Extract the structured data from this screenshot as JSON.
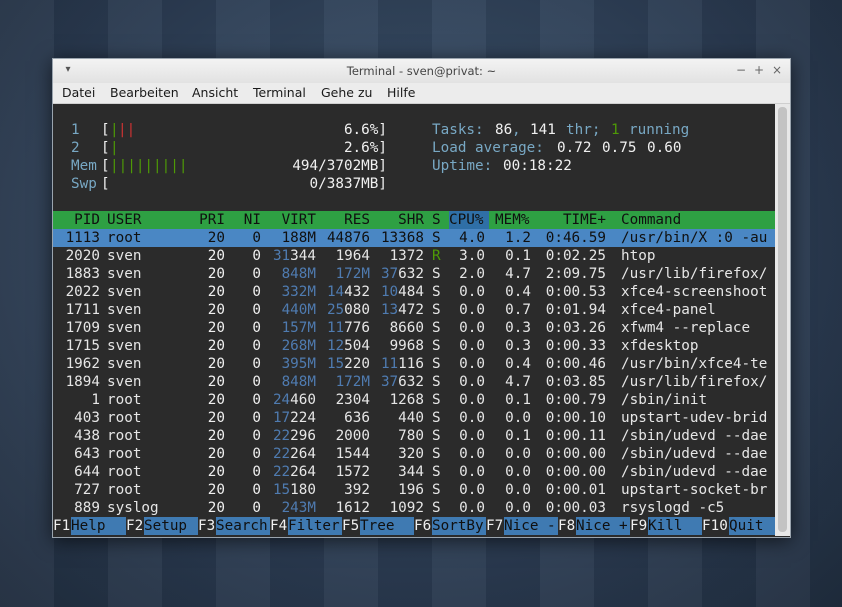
{
  "window": {
    "title": "Terminal - sven@privat: ~",
    "controls": {
      "menu": "▾",
      "minimize": "−",
      "maximize": "+",
      "close": "×"
    }
  },
  "menubar": [
    "Datei",
    "Bearbeiten",
    "Ansicht",
    "Terminal",
    "Gehe zu",
    "Hilfe"
  ],
  "meters": {
    "cpu1": {
      "label": "1",
      "open": "[",
      "bar_red": "||",
      "bar_green": "|",
      "value": "6.6%]"
    },
    "cpu2": {
      "label": "2",
      "open": "[",
      "bar_green": "|",
      "value": "2.6%]"
    },
    "mem": {
      "label": "Mem",
      "open": "[",
      "bar_green": "|||||||||",
      "value": "494/3702MB]"
    },
    "swp": {
      "label": "Swp",
      "open": "[",
      "value": "0/3837MB]"
    }
  },
  "stats": {
    "tasks_label": "Tasks:",
    "tasks": "86",
    "thr_count": "141",
    "thr_label": "thr;",
    "running_count": "1",
    "running_label": "running",
    "load_label": "Load average:",
    "load1": "0.72",
    "load5": "0.75",
    "load15": "0.60",
    "uptime_label": "Uptime:",
    "uptime": "00:18:22"
  },
  "table": {
    "headers": [
      "PID",
      "USER",
      "PRI",
      "NI",
      "VIRT",
      "RES",
      "SHR",
      "S",
      "CPU%",
      "MEM%",
      "TIME+",
      "Command"
    ],
    "sorted_column": "CPU%",
    "selected_row": 0,
    "rows": [
      {
        "pid": "1113",
        "user": "root",
        "pri": "20",
        "ni": "0",
        "virt": "188M",
        "res": "44876",
        "shr": "13368",
        "s": "S",
        "cpu": "4.0",
        "mem": "1.2",
        "time": "0:46.59",
        "cmd": "/usr/bin/X :0 -au"
      },
      {
        "pid": "2020",
        "user": "sven",
        "pri": "20",
        "ni": "0",
        "virt": "31344",
        "res": "1964",
        "shr": "1372",
        "s": "R",
        "cpu": "3.0",
        "mem": "0.1",
        "time": "0:02.25",
        "cmd": "htop"
      },
      {
        "pid": "1883",
        "user": "sven",
        "pri": "20",
        "ni": "0",
        "virt": "848M",
        "res": "172M",
        "shr": "37632",
        "s": "S",
        "cpu": "2.0",
        "mem": "4.7",
        "time": "2:09.75",
        "cmd": "/usr/lib/firefox/"
      },
      {
        "pid": "2022",
        "user": "sven",
        "pri": "20",
        "ni": "0",
        "virt": "332M",
        "res": "14432",
        "shr": "10484",
        "s": "S",
        "cpu": "0.0",
        "mem": "0.4",
        "time": "0:00.53",
        "cmd": "xfce4-screenshoot"
      },
      {
        "pid": "1711",
        "user": "sven",
        "pri": "20",
        "ni": "0",
        "virt": "440M",
        "res": "25080",
        "shr": "13472",
        "s": "S",
        "cpu": "0.0",
        "mem": "0.7",
        "time": "0:01.94",
        "cmd": "xfce4-panel"
      },
      {
        "pid": "1709",
        "user": "sven",
        "pri": "20",
        "ni": "0",
        "virt": "157M",
        "res": "11776",
        "shr": "8660",
        "s": "S",
        "cpu": "0.0",
        "mem": "0.3",
        "time": "0:03.26",
        "cmd": "xfwm4 --replace"
      },
      {
        "pid": "1715",
        "user": "sven",
        "pri": "20",
        "ni": "0",
        "virt": "268M",
        "res": "12504",
        "shr": "9968",
        "s": "S",
        "cpu": "0.0",
        "mem": "0.3",
        "time": "0:00.33",
        "cmd": "xfdesktop"
      },
      {
        "pid": "1962",
        "user": "sven",
        "pri": "20",
        "ni": "0",
        "virt": "395M",
        "res": "15220",
        "shr": "11116",
        "s": "S",
        "cpu": "0.0",
        "mem": "0.4",
        "time": "0:00.46",
        "cmd": "/usr/bin/xfce4-te"
      },
      {
        "pid": "1894",
        "user": "sven",
        "pri": "20",
        "ni": "0",
        "virt": "848M",
        "res": "172M",
        "shr": "37632",
        "s": "S",
        "cpu": "0.0",
        "mem": "4.7",
        "time": "0:03.85",
        "cmd": "/usr/lib/firefox/"
      },
      {
        "pid": "1",
        "user": "root",
        "pri": "20",
        "ni": "0",
        "virt": "24460",
        "res": "2304",
        "shr": "1268",
        "s": "S",
        "cpu": "0.0",
        "mem": "0.1",
        "time": "0:00.79",
        "cmd": "/sbin/init"
      },
      {
        "pid": "403",
        "user": "root",
        "pri": "20",
        "ni": "0",
        "virt": "17224",
        "res": "636",
        "shr": "440",
        "s": "S",
        "cpu": "0.0",
        "mem": "0.0",
        "time": "0:00.10",
        "cmd": "upstart-udev-brid"
      },
      {
        "pid": "438",
        "user": "root",
        "pri": "20",
        "ni": "0",
        "virt": "22296",
        "res": "2000",
        "shr": "780",
        "s": "S",
        "cpu": "0.0",
        "mem": "0.1",
        "time": "0:00.11",
        "cmd": "/sbin/udevd --dae"
      },
      {
        "pid": "643",
        "user": "root",
        "pri": "20",
        "ni": "0",
        "virt": "22264",
        "res": "1544",
        "shr": "320",
        "s": "S",
        "cpu": "0.0",
        "mem": "0.0",
        "time": "0:00.00",
        "cmd": "/sbin/udevd --dae"
      },
      {
        "pid": "644",
        "user": "root",
        "pri": "20",
        "ni": "0",
        "virt": "22264",
        "res": "1572",
        "shr": "344",
        "s": "S",
        "cpu": "0.0",
        "mem": "0.0",
        "time": "0:00.00",
        "cmd": "/sbin/udevd --dae"
      },
      {
        "pid": "727",
        "user": "root",
        "pri": "20",
        "ni": "0",
        "virt": "15180",
        "res": "392",
        "shr": "196",
        "s": "S",
        "cpu": "0.0",
        "mem": "0.0",
        "time": "0:00.01",
        "cmd": "upstart-socket-br"
      },
      {
        "pid": "889",
        "user": "syslog",
        "pri": "20",
        "ni": "0",
        "virt": "243M",
        "res": "1612",
        "shr": "1092",
        "s": "S",
        "cpu": "0.0",
        "mem": "0.0",
        "time": "0:00.03",
        "cmd": "rsyslogd -c5"
      }
    ]
  },
  "fkeys": [
    {
      "key": "F1",
      "label": "Help"
    },
    {
      "key": "F2",
      "label": "Setup"
    },
    {
      "key": "F3",
      "label": "Search"
    },
    {
      "key": "F4",
      "label": "Filter"
    },
    {
      "key": "F5",
      "label": "Tree"
    },
    {
      "key": "F6",
      "label": "SortBy"
    },
    {
      "key": "F7",
      "label": "Nice -"
    },
    {
      "key": "F8",
      "label": "Nice +"
    },
    {
      "key": "F9",
      "label": "Kill"
    },
    {
      "key": "F10",
      "label": "Quit"
    }
  ],
  "colors": {
    "header_bg": "#2ea043",
    "sorted_col_bg": "#2f6fa7",
    "selected_row_bg": "#4a87c4",
    "fkey_label_bg": "#3f7ab2",
    "terminal_bg": "#2b2b2b",
    "accent_cyan": "#78a8c4"
  }
}
